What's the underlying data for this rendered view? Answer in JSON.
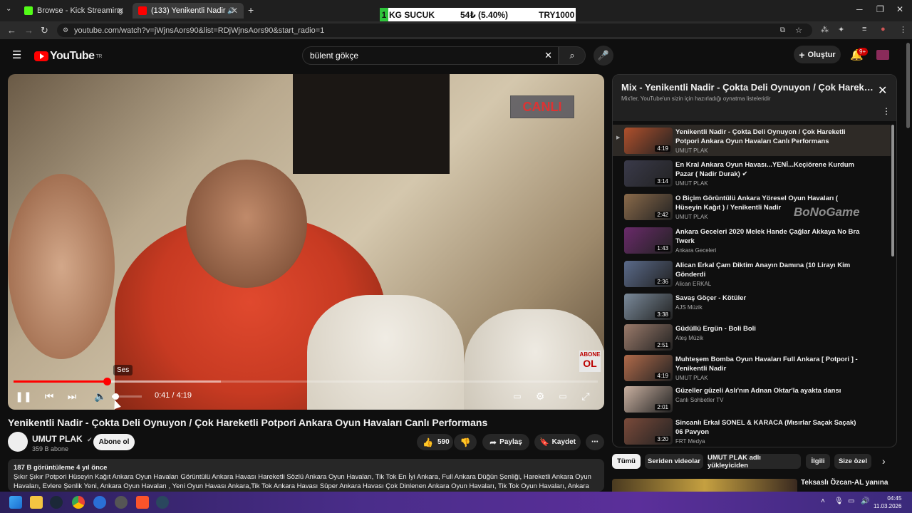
{
  "browser": {
    "tabs": [
      {
        "title": "Browse - Kick Streaming",
        "favicon_color": "#53fc18"
      },
      {
        "title": "(133) Yenikentli Nadir - Çok",
        "favicon_color": "#ff0000"
      }
    ],
    "url": "youtube.com/watch?v=jWjnsAors90&list=RDjWjnsAors90&start_radio=1",
    "new_tab_symbol": "+"
  },
  "ticker": {
    "lead": "1",
    "symbol": "KG SUCUK",
    "change": "54₺ (5.40%)",
    "price": "TRY1000"
  },
  "youtube": {
    "logo_text": "YouTube",
    "logo_sup": "TR",
    "search_value": "bülent gökçe",
    "create_label": "Oluştur",
    "notif_badge": "9+"
  },
  "player": {
    "canli_label": "CANLI",
    "abone_small": "ABONE",
    "abone_big": "OL",
    "tooltip": "Ses",
    "time": "0:41 / 4:19",
    "progress_fraction": 0.16,
    "buffer_fraction": 0.355,
    "volume_fraction": 0.12
  },
  "video": {
    "title": "Yenikentli Nadir - Çokta Deli Oynuyon / Çok Hareketli Potpori Ankara Oyun Havaları Canlı Performans",
    "channel": "UMUT PLAK",
    "subscribers": "359 B abone",
    "subscribe_label": "Abone ol",
    "likes": "590",
    "share_label": "Paylaş",
    "save_label": "Kaydet",
    "views_date": "187 B görüntüleme  4 yıl önce",
    "description": "Şıkır Şıkır Potpori Hüseyin Kağıt Ankara Oyun Havaları Görüntülü Ankara Havası Hareketli Sözlü Ankara Oyun Havaları, Tik Tok En İyi Ankara,  Full Ankara Düğün Şenliği, Hareketli Ankara Oyun Havaları, Evlere Şenlik Yeni,  Ankara Oyun Havaları , Yeni Oyun Havası Ankara,Tik Tok Ankara Havası Süper Ankara Havası  Çok Dinlenen Ankara Oyun Havaları, Tik Tok Oyun Havaları, Ankara Havası, Yep Yeni"
  },
  "playlist": {
    "title": "Mix - Yenikentli Nadir - Çokta Deli Oynuyon / Çok Hareketli Potpori Ankara Oyun Havaları Canlı Performans",
    "subtitle": "Mix'ler, YouTube'un sizin için hazırladığı oynatma listeleridir",
    "now_playing_marker": "▶",
    "items": [
      {
        "title": "Yenikentli Nadir - Çokta Deli Oynuyon / Çok Hareketli Potpori Ankara Oyun Havaları Canlı Performans",
        "channel": "UMUT PLAK",
        "duration": "4:19",
        "thumb": "#b0502c"
      },
      {
        "title": "En Kral Ankara Oyun Havası...YENİ...Keçiörene Kurdum Pazar ( Nadir Durak) ✔",
        "channel": "UMUT PLAK",
        "duration": "3:14",
        "thumb": "#3a3a4a"
      },
      {
        "title": "O Biçim Görüntülü Ankara Yöresel Oyun Havaları ( Hüseyin Kağıt ) / Yenikentli Nadir",
        "channel": "UMUT PLAK",
        "duration": "2:42",
        "thumb": "#8a6a4a"
      },
      {
        "title": "Ankara Geceleri 2020 Melek Hande Çağlar Akkaya No Bra Twerk",
        "channel": "Ankara Geceleri",
        "duration": "1:43",
        "thumb": "#6a2a6a"
      },
      {
        "title": "Alican Erkal Çam Diktim Anayın Damına (10 Lirayı Kim Gönderdi",
        "channel": "Alican ERKAL",
        "duration": "2:36",
        "thumb": "#5a6a8a"
      },
      {
        "title": "Savaş Göçer - Kötüler",
        "channel": "AJS Müzik",
        "duration": "3:38",
        "thumb": "#7a8a9a"
      },
      {
        "title": "Güdüllü Ergün - Boli Boli",
        "channel": "Ateş Müzik",
        "duration": "2:51",
        "thumb": "#9a7a6a"
      },
      {
        "title": "Muhteşem Bomba Oyun Havaları Full Ankara [ Potpori ] - Yenikentli Nadir",
        "channel": "UMUT PLAK",
        "duration": "4:19",
        "thumb": "#b06a4a"
      },
      {
        "title": "Güzeller güzeli Aslı'nın Adnan Oktar'la ayakta dansı",
        "channel": "Canlı Sohbetler TV",
        "duration": "2:01",
        "thumb": "#c9b0a0"
      },
      {
        "title": "Sincanlı Erkal SONEL & KARACA (Mısırlar Saçak Saçak) 06 Pavyon",
        "channel": "FRT Medya",
        "duration": "3:20",
        "thumb": "#7a4a3a"
      }
    ]
  },
  "watermark": "BoNoGame",
  "chips": [
    "Tümü",
    "Seriden videolar",
    "UMUT PLAK adlı yükleyiciden",
    "İlgili",
    "Size özel"
  ],
  "next_up_title": "Teksaslı Özcan-AL yanına",
  "taskbar": {
    "time": "04:45",
    "date": "11.03.2026"
  }
}
